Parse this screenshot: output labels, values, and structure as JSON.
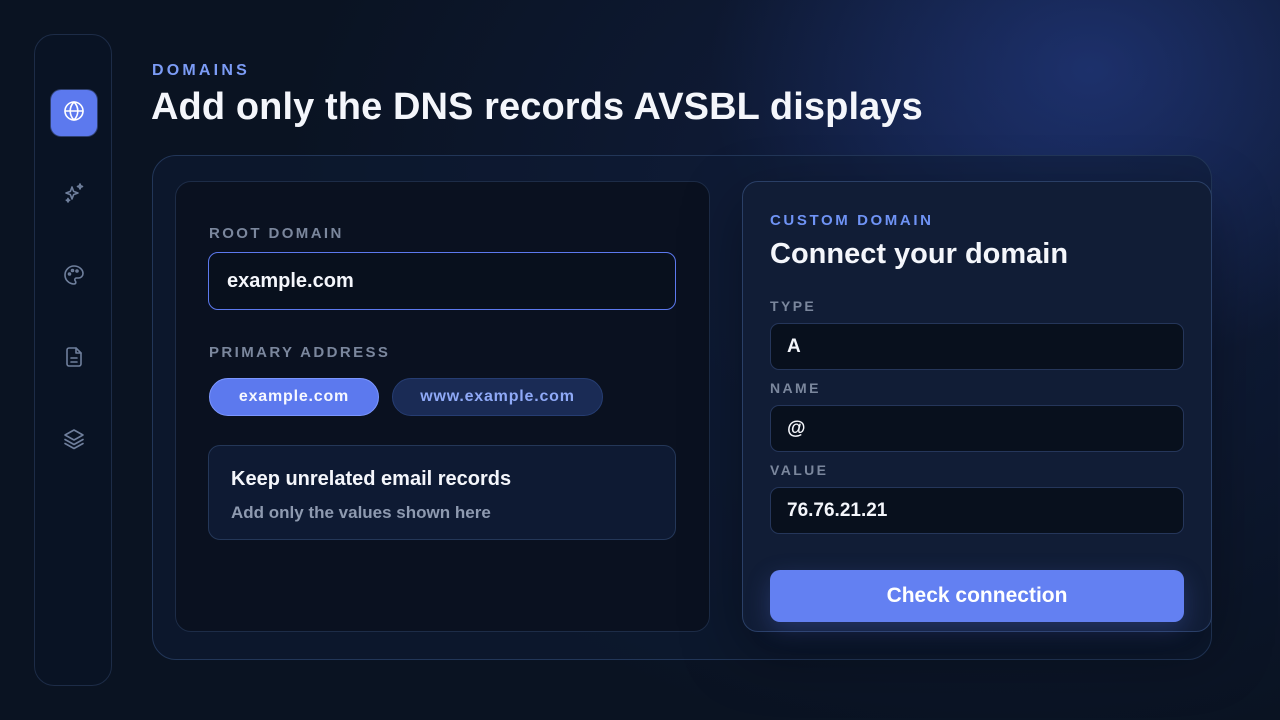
{
  "sidebar": {
    "items": [
      {
        "icon": "globe-icon",
        "active": true
      },
      {
        "icon": "sparkles-icon",
        "active": false
      },
      {
        "icon": "palette-icon",
        "active": false
      },
      {
        "icon": "document-icon",
        "active": false
      },
      {
        "icon": "layers-icon",
        "active": false
      }
    ]
  },
  "header": {
    "eyebrow": "DOMAINS",
    "title": "Add only the DNS records AVSBL displays"
  },
  "left_panel": {
    "root_domain_label": "ROOT DOMAIN",
    "root_domain_value": "example.com",
    "primary_address_label": "PRIMARY ADDRESS",
    "primary_options": [
      {
        "label": "example.com",
        "selected": true
      },
      {
        "label": "www.example.com",
        "selected": false
      }
    ],
    "note": {
      "title": "Keep unrelated email records",
      "subtitle": "Add only the values shown here"
    }
  },
  "right_panel": {
    "eyebrow": "CUSTOM DOMAIN",
    "title": "Connect your domain",
    "fields": [
      {
        "label": "TYPE",
        "value": "A"
      },
      {
        "label": "NAME",
        "value": "@"
      },
      {
        "label": "VALUE",
        "value": "76.76.21.21"
      }
    ],
    "button_label": "Check connection"
  },
  "colors": {
    "accent": "#5c79ee",
    "background": "#0a1322",
    "eyebrow": "#7c9cf6"
  }
}
